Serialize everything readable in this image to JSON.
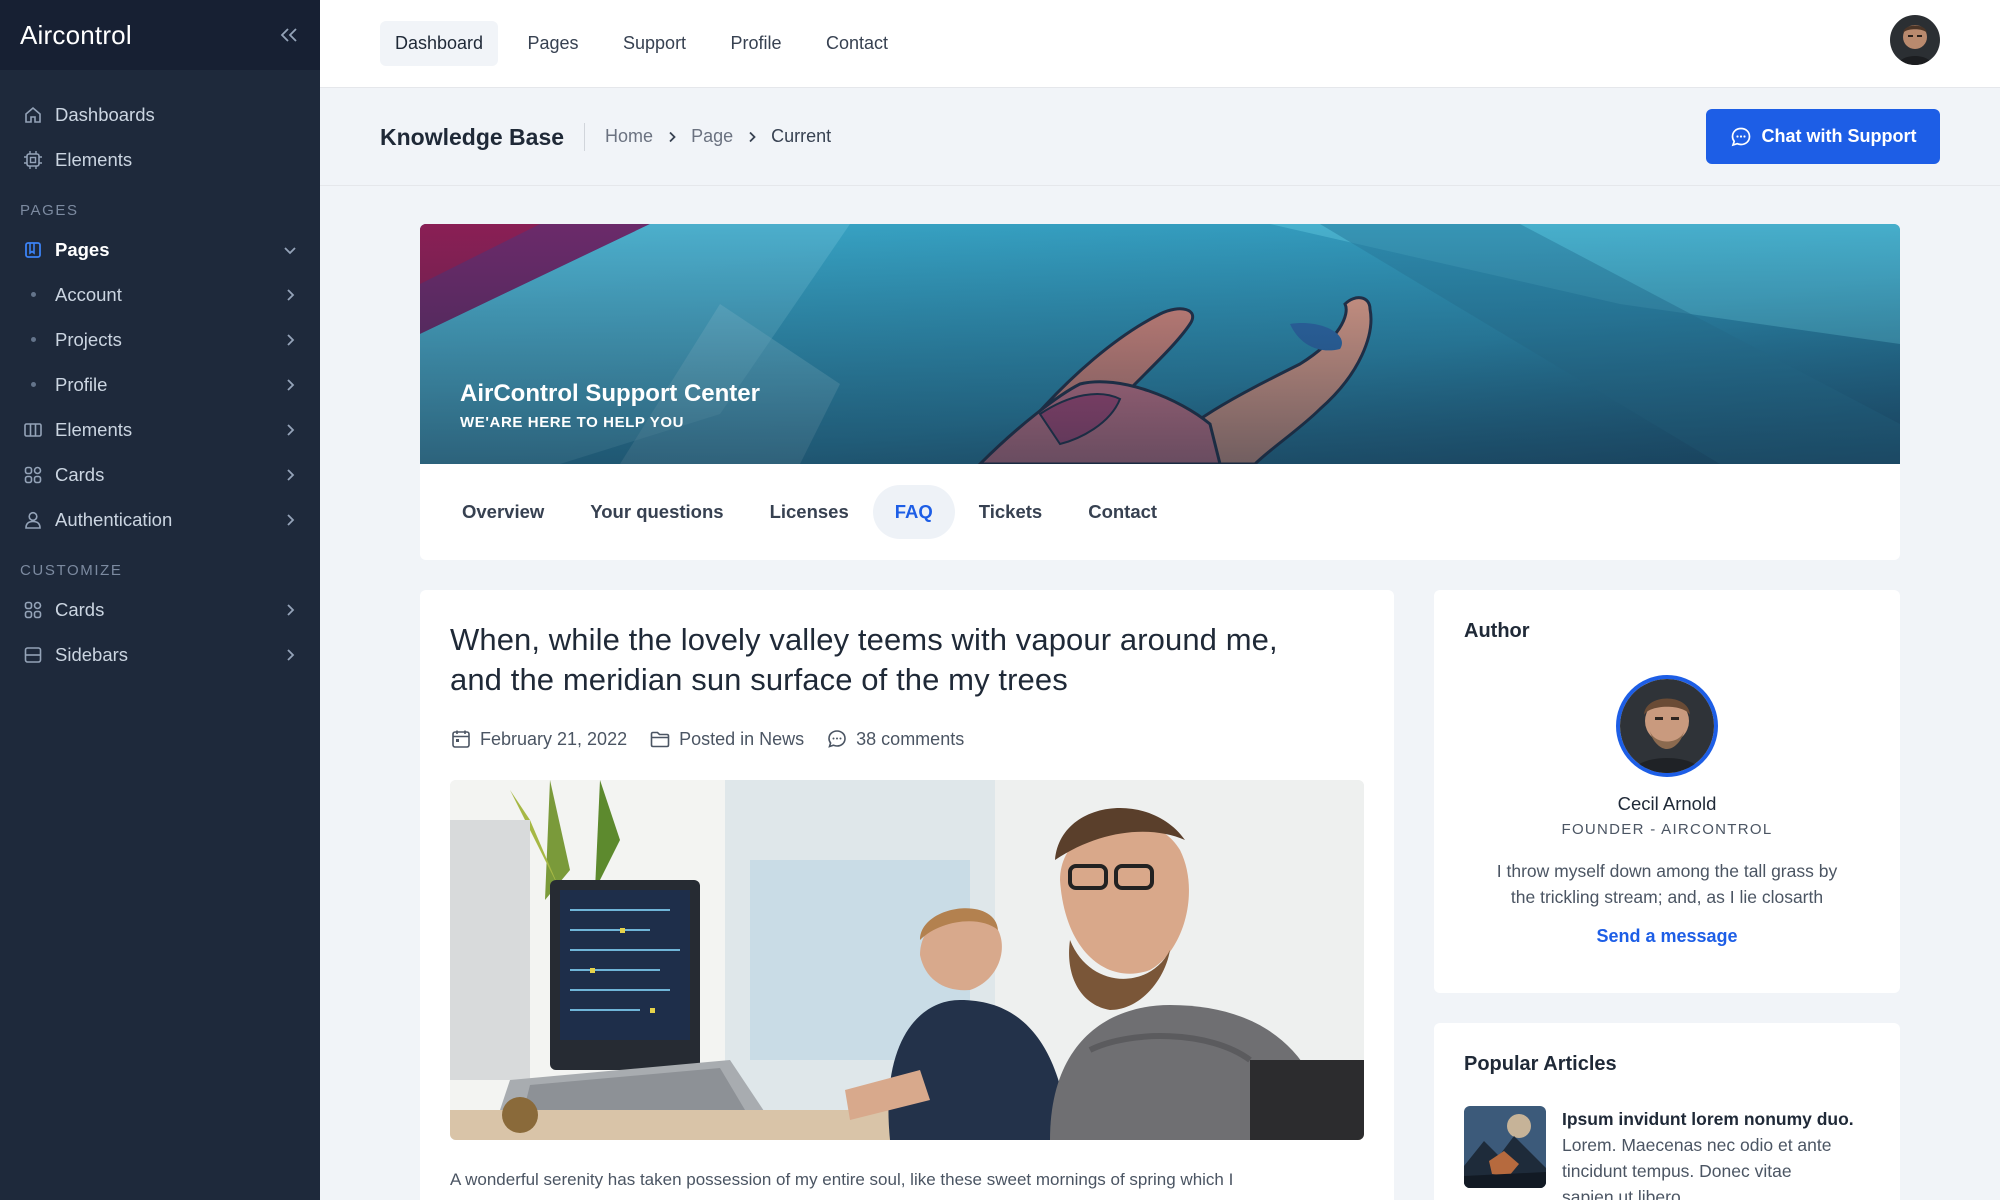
{
  "app": {
    "name": "Aircontrol"
  },
  "sidebar": {
    "items_top": [
      {
        "label": "Dashboards",
        "icon": "home-icon"
      },
      {
        "label": "Elements",
        "icon": "chip-icon"
      }
    ],
    "section_pages": "PAGES",
    "pages": {
      "label": "Pages",
      "icon": "book-icon"
    },
    "sub_items": [
      {
        "label": "Account"
      },
      {
        "label": "Projects"
      },
      {
        "label": "Profile"
      }
    ],
    "items_mid": [
      {
        "label": "Elements",
        "icon": "columns-icon"
      },
      {
        "label": "Cards",
        "icon": "grid-icon"
      },
      {
        "label": "Authentication",
        "icon": "user-icon"
      }
    ],
    "section_customize": "CUSTOMIZE",
    "items_bottom": [
      {
        "label": "Cards",
        "icon": "grid-icon"
      },
      {
        "label": "Sidebars",
        "icon": "sidebar-icon"
      }
    ]
  },
  "topnav": {
    "items": [
      {
        "label": "Dashboard",
        "active": true
      },
      {
        "label": "Pages"
      },
      {
        "label": "Support"
      },
      {
        "label": "Profile"
      },
      {
        "label": "Contact"
      }
    ]
  },
  "subheader": {
    "title": "Knowledge Base",
    "breadcrumb": [
      "Home",
      "Page",
      "Current"
    ],
    "chat_button": "Chat with Support"
  },
  "hero": {
    "title": "AirControl Support Center",
    "subtitle": "WE'ARE HERE TO HELP YOU"
  },
  "tabs": [
    "Overview",
    "Your questions",
    "Licenses",
    "FAQ",
    "Tickets",
    "Contact"
  ],
  "active_tab": "FAQ",
  "article": {
    "title_line1": "When, while the lovely valley teems with vapour around me,",
    "title_line2": "and the meridian sun surface of the my trees",
    "date": "February 21, 2022",
    "category": "Posted in News",
    "comments": "38 comments",
    "body": "A wonderful serenity has taken possession of my entire soul, like these sweet mornings of spring which I"
  },
  "author": {
    "heading": "Author",
    "name": "Cecil Arnold",
    "role": "FOUNDER - AIRCONTROL",
    "bio_line1": "I throw myself down among the tall grass by",
    "bio_line2": "the trickling stream; and, as I lie closarth",
    "link": "Send a message"
  },
  "popular": {
    "heading": "Popular Articles",
    "items": [
      {
        "title": "Ipsum invidunt lorem nonumy duo.",
        "excerpt_line1": "Lorem. Maecenas nec odio et ante",
        "excerpt_line2": "tincidunt tempus. Donec vitae",
        "excerpt_line3": "sapien ut libero"
      }
    ]
  },
  "colors": {
    "accent": "#1d5ee6",
    "sidebar": "#1e293b",
    "sidebar_head": "#172033",
    "page_bg": "#f1f4f8"
  }
}
